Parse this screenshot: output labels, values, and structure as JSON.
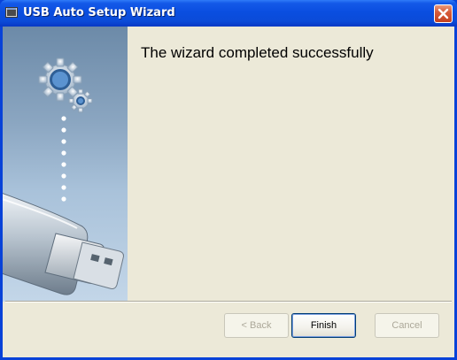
{
  "window": {
    "title": "USB Auto Setup Wizard",
    "accent_color": "#0a4ee0",
    "close_icon": "close-icon"
  },
  "side_panel": {
    "illustration": [
      "gears-icon",
      "usb-drive-icon"
    ]
  },
  "main": {
    "heading": "The wizard completed successfully"
  },
  "buttons": {
    "back": {
      "label": "< Back",
      "enabled": false
    },
    "finish": {
      "label": "Finish",
      "enabled": true
    },
    "cancel": {
      "label": "Cancel",
      "enabled": false
    }
  }
}
